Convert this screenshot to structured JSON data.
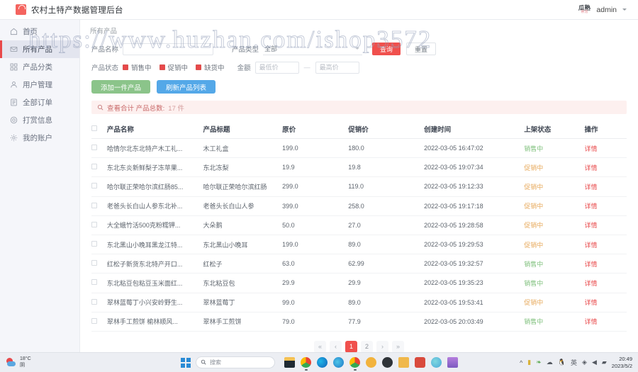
{
  "header": {
    "title": "农村土特产数据管理后台",
    "logo_icon": "shop-bag-icon",
    "avatar_line1": "瓜熟",
    "avatar_line2": "蒂落",
    "user_name": "admin",
    "caret_icon": "chevron-down-icon"
  },
  "sidebar": {
    "items": [
      {
        "label": "首页",
        "icon": "home-icon",
        "active": false
      },
      {
        "label": "所有产品",
        "icon": "mail-icon",
        "active": true
      },
      {
        "label": "产品分类",
        "icon": "grid-icon",
        "active": false
      },
      {
        "label": "用户管理",
        "icon": "user-icon",
        "active": false
      },
      {
        "label": "全部订单",
        "icon": "list-icon",
        "active": false
      },
      {
        "label": "打赏信息",
        "icon": "coin-icon",
        "active": false
      },
      {
        "label": "我的账户",
        "icon": "gear-icon",
        "active": false
      }
    ]
  },
  "breadcrumb": "所有产品",
  "filter": {
    "name_label": "产品名称",
    "name_value": "",
    "name_placeholder": "",
    "type_label": "产品类型",
    "type_value": "全部",
    "query_button": "查询",
    "reset_button": "重置",
    "status_label": "产品状态",
    "status_options": [
      "销售中",
      "促销中",
      "缺货中"
    ],
    "amount_label": "金额",
    "amount_min_placeholder": "最低价",
    "amount_max_placeholder": "最高价",
    "amount_separator": "—",
    "add_button": "添加一件产品",
    "refresh_button": "刷新产品列表"
  },
  "alert": {
    "icon": "search-icon",
    "text": "查看合计  产品总数:",
    "count": "17 件"
  },
  "table": {
    "columns": [
      "产品名称",
      "产品标题",
      "原价",
      "促销价",
      "创建时间",
      "上架状态",
      "操作"
    ],
    "action_label": "详情",
    "rows": [
      {
        "name": "哈情尔北东北特产木工礼...",
        "title": "木工礼盒",
        "price": "199.0",
        "promo": "180.0",
        "created": "2022-03-05 16:47:02",
        "state": "销售中",
        "state_type": "sale"
      },
      {
        "name": "东北东炎新鲜梨子冻苹果...",
        "title": "东北冻梨",
        "price": "19.9",
        "promo": "19.8",
        "created": "2022-03-05 19:07:34",
        "state": "促销中",
        "state_type": "promo"
      },
      {
        "name": "哈尔联正荣哈尔滨红肠85...",
        "title": "哈尔联正荣哈尔滨红肠",
        "price": "299.0",
        "promo": "119.0",
        "created": "2022-03-05 19:12:33",
        "state": "促销中",
        "state_type": "promo"
      },
      {
        "name": "老爸头长白山人参东北补...",
        "title": "老爸头长白山人参",
        "price": "399.0",
        "promo": "258.0",
        "created": "2022-03-05 19:17:18",
        "state": "促销中",
        "state_type": "promo"
      },
      {
        "name": "大全蛾竹活500克粉糯钾...",
        "title": "大朵鹅",
        "price": "50.0",
        "promo": "27.0",
        "created": "2022-03-05 19:28:58",
        "state": "促销中",
        "state_type": "promo"
      },
      {
        "name": "东北黑山小晚耳黑龙江特...",
        "title": "东北黑山小晚耳",
        "price": "199.0",
        "promo": "89.0",
        "created": "2022-03-05 19:29:53",
        "state": "促销中",
        "state_type": "promo"
      },
      {
        "name": "红松子新货东北特产开口...",
        "title": "红松子",
        "price": "63.0",
        "promo": "62.99",
        "created": "2022-03-05 19:32:57",
        "state": "销售中",
        "state_type": "sale"
      },
      {
        "name": "东北粘豆包粘豆玉米面红...",
        "title": "东北粘豆包",
        "price": "29.9",
        "promo": "29.9",
        "created": "2022-03-05 19:35:23",
        "state": "销售中",
        "state_type": "sale"
      },
      {
        "name": "翠林蓝莓丁小兴安岭野生...",
        "title": "翠林蓝莓丁",
        "price": "99.0",
        "promo": "89.0",
        "created": "2022-03-05 19:53:41",
        "state": "促销中",
        "state_type": "promo"
      },
      {
        "name": "翠林手工煎饼 榆林顺风...",
        "title": "翠林手工煎饼",
        "price": "79.0",
        "promo": "77.9",
        "created": "2022-03-05 20:03:49",
        "state": "销售中",
        "state_type": "sale"
      }
    ]
  },
  "pagination": {
    "items": [
      "«",
      "‹",
      "1",
      "2",
      "›",
      "»"
    ],
    "active": "1"
  },
  "watermark": "https://www.huzhan.com/ishop3572",
  "taskbar": {
    "weather_temp": "18°C",
    "weather_desc": "阴",
    "search_placeholder": "搜索",
    "search_icon": "search-icon",
    "start_icon": "windows-icon",
    "clock_time": "20:49",
    "clock_date": "2023/5/2",
    "tray_icons": [
      "chevron-up-icon",
      "battery-icon",
      "leaf-icon",
      "cloud-icon",
      "qq-icon",
      "ime-icon",
      "wifi-icon",
      "speaker-icon",
      "net-icon"
    ]
  },
  "colors": {
    "accent_red": "#e8484a",
    "btn_green": "#8bc48a",
    "btn_blue": "#54a8e8",
    "state_sale": "#7fc07c",
    "state_promo": "#e7a95b"
  }
}
